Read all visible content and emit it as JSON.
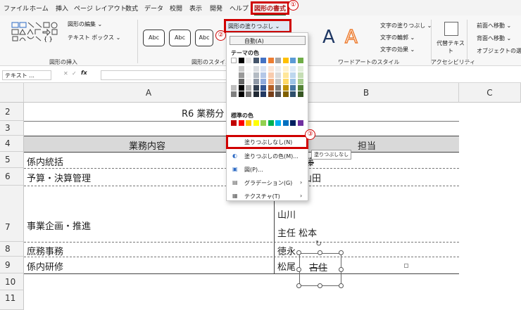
{
  "tabs": [
    "ファイル",
    "ホーム",
    "挿入",
    "ページ レイアウト",
    "数式",
    "データ",
    "校閲",
    "表示",
    "開発",
    "ヘルプ",
    "図形の書式"
  ],
  "markers": [
    "①",
    "②",
    "③"
  ],
  "ribbon": {
    "edit_shape": "図形の編集 ⌄",
    "textbox": "テキスト ボックス ⌄",
    "group_insert": "図形の挿入",
    "style_label": "Abc",
    "group_style": "図形のスタイル",
    "fill_button": "図形の塗りつぶし ⌄",
    "wordart_letter": "A",
    "text_fill": "文字の塗りつぶし ⌄",
    "text_outline": "文字の輪郭 ⌄",
    "text_effect": "文字の効果 ⌄",
    "group_wordart": "ワードアートのスタイル",
    "alt_text": "代替テキスト",
    "group_access": "アクセシビリティ",
    "bring_forward": "前面へ移動 ⌄",
    "send_backward": "背面へ移動 ⌄",
    "selection_pane": "オブジェクトの選択"
  },
  "formula_bar": {
    "name_box": "テキスト ...",
    "fx": "fx"
  },
  "columns": [
    "A",
    "B",
    "C"
  ],
  "rows": [
    "2",
    "3",
    "4",
    "5",
    "6",
    "7",
    "8",
    "9",
    "10",
    "11"
  ],
  "sheet": {
    "title": "R6 業務分",
    "header_a": "業務内容",
    "header_b": "担当",
    "a5": "係内統括",
    "b5": "佐藤",
    "a6": "予算・決算管理",
    "b6": "山田",
    "a7": "事業企画・推進",
    "b7a": "山川",
    "b7b": "主任 松本",
    "a8": "庶務事務",
    "b8": "徳永",
    "a9": "係内研修",
    "b9a": "松尾",
    "b9b": "古住"
  },
  "dropdown": {
    "auto": "自動(A)",
    "theme_title": "テーマの色",
    "std_title": "標準の色",
    "no_fill": "塗りつぶしなし(N)",
    "more_colors": "塗りつぶしの色(M)...",
    "picture": "図(P)...",
    "gradient": "グラデーション(G)",
    "texture": "テクスチャ(T)",
    "tooltip": "塗りつぶしなし",
    "theme_colors": [
      "#ffffff",
      "#000000",
      "#e7e6e6",
      "#44546a",
      "#4472c4",
      "#ed7d31",
      "#a5a5a5",
      "#ffc000",
      "#5b9bd5",
      "#70ad47"
    ],
    "standard_colors": [
      "#c00000",
      "#ff0000",
      "#ffc000",
      "#ffff00",
      "#92d050",
      "#00b050",
      "#00b0f0",
      "#0070c0",
      "#002060",
      "#7030a0"
    ]
  },
  "accent": {
    "highlight": "#d00000",
    "tab_active": "#b01818"
  }
}
